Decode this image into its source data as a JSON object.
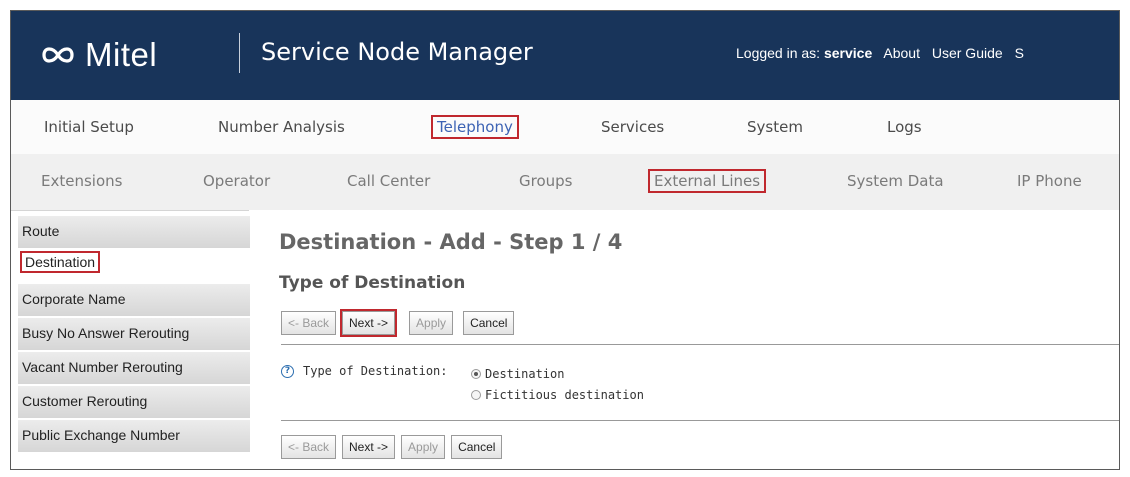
{
  "header": {
    "logo_text": "Mitel",
    "app_title": "Service Node Manager",
    "logged_in_prefix": "Logged in as: ",
    "logged_in_user": "service",
    "links": [
      "About",
      "User Guide",
      "S"
    ]
  },
  "main_menu": {
    "items": [
      "Initial Setup",
      "Number Analysis",
      "Telephony",
      "Services",
      "System",
      "Logs"
    ],
    "selected": "Telephony"
  },
  "sub_menu": {
    "items": [
      "Extensions",
      "Operator",
      "Call Center",
      "Groups",
      "External Lines",
      "System Data",
      "IP Phone"
    ],
    "selected": "External Lines"
  },
  "sidebar": {
    "items": [
      "Route",
      "Destination",
      "Corporate Name",
      "Busy No Answer Rerouting",
      "Vacant Number Rerouting",
      "Customer Rerouting",
      "Public Exchange Number"
    ],
    "selected": "Destination"
  },
  "content": {
    "title": "Destination - Add - Step  1 / 4",
    "section_title": "Type of Destination",
    "buttons": {
      "back": "<- Back",
      "next": "Next ->",
      "apply": "Apply",
      "cancel": "Cancel"
    },
    "field": {
      "help_icon": "?",
      "label": "Type of Destination:",
      "options": [
        "Destination",
        "Fictitious destination"
      ],
      "selected": "Destination"
    }
  },
  "colors": {
    "header_bg": "#18345a",
    "highlight_box": "#c0282e",
    "link_blue": "#3d63b4"
  }
}
